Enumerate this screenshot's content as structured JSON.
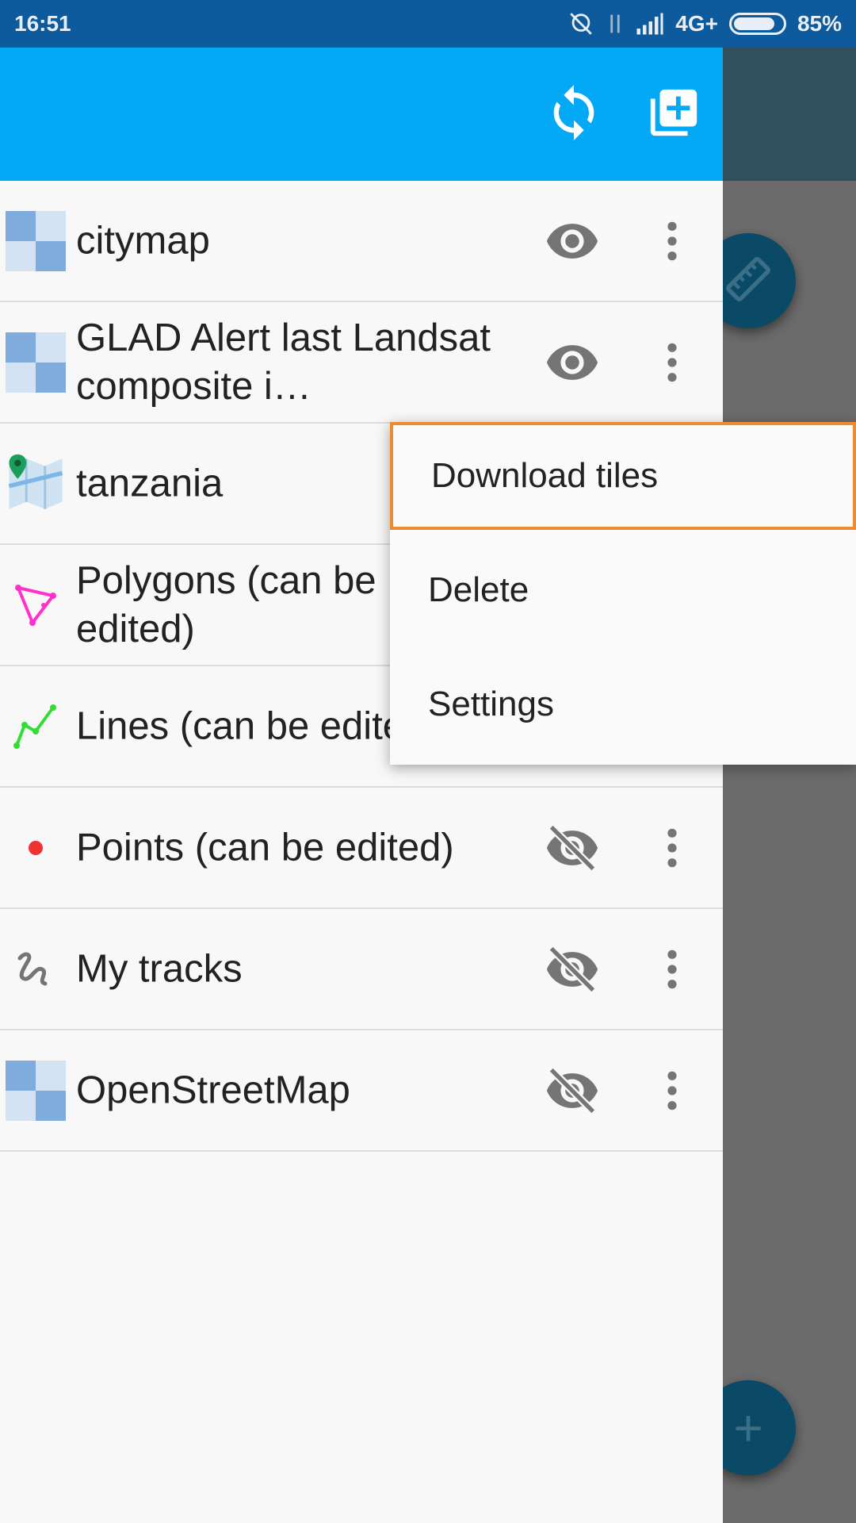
{
  "status_bar": {
    "time": "16:51",
    "network": "4G+",
    "battery_percent": "85%",
    "battery_level": 0.85,
    "icons": [
      "alarm-off-icon",
      "data-arrows-icon",
      "signal-icon",
      "battery-icon"
    ]
  },
  "header": {
    "actions": [
      "sync-icon",
      "add-layer-icon"
    ]
  },
  "layers": [
    {
      "label": "citymap",
      "icon": "tile-layer-icon",
      "visible": true
    },
    {
      "label": "GLAD Alert last Landsat composite i…",
      "icon": "tile-layer-icon",
      "visible": true
    },
    {
      "label": "tanzania",
      "icon": "map-pin-icon",
      "visible": true
    },
    {
      "label": "Polygons (can be edited)",
      "icon": "polygon-icon",
      "visible": true
    },
    {
      "label": "Lines (can be edited)",
      "icon": "line-icon",
      "visible": true
    },
    {
      "label": "Points (can be edited)",
      "icon": "point-icon",
      "visible": false
    },
    {
      "label": "My tracks",
      "icon": "track-icon",
      "visible": false
    },
    {
      "label": "OpenStreetMap",
      "icon": "tile-layer-icon",
      "visible": false
    }
  ],
  "menu": {
    "items": [
      "Download tiles",
      "Delete",
      "Settings"
    ],
    "highlighted": "Download tiles"
  },
  "colors": {
    "status_bar": "#0d5a9c",
    "header": "#03a9f4",
    "highlight_border": "#f08a32",
    "polygon": "#ff33cc",
    "line": "#33dd33",
    "point": "#ee3333"
  }
}
